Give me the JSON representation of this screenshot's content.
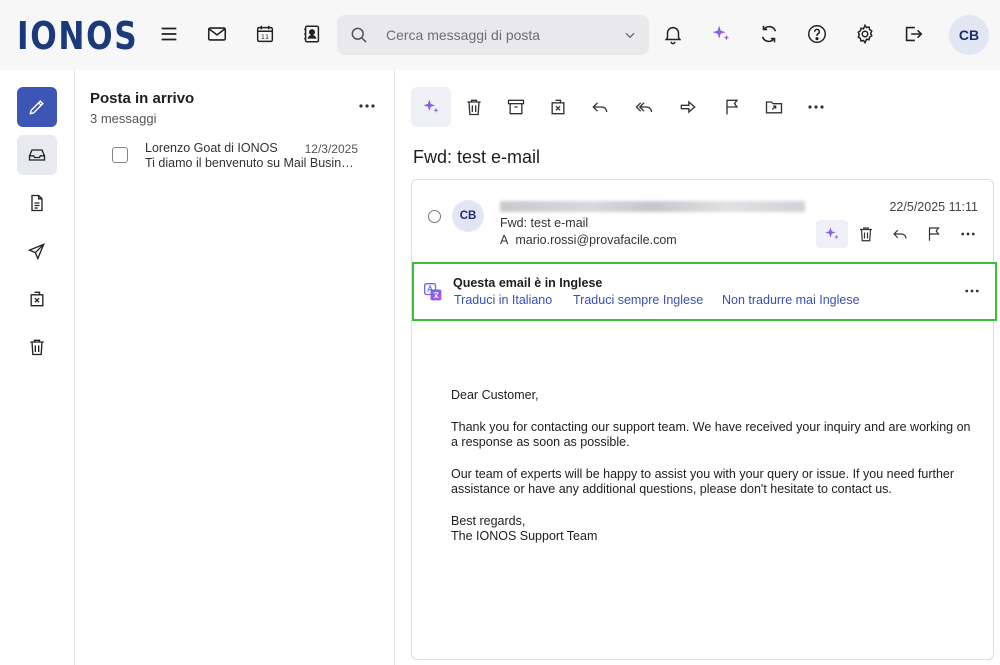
{
  "brand": {
    "logo": "IONOS"
  },
  "topbar": {
    "search_placeholder": "Cerca messaggi di posta",
    "avatar": "CB",
    "icons": [
      "menu-icon",
      "mail-icon",
      "calendar-icon",
      "contacts-icon",
      "bell-icon",
      "ai-sparkle-icon",
      "sync-icon",
      "help-icon",
      "gear-icon",
      "logout-icon"
    ],
    "calendar_day": "11",
    "accent": "#3d55b5"
  },
  "sidebar": {
    "items": [
      "compose",
      "inbox",
      "drafts",
      "sent",
      "spam",
      "trash"
    ]
  },
  "list": {
    "title": "Posta in arrivo",
    "count": "3 messaggi",
    "messages": [
      {
        "sender": "Lorenzo Goat di IONOS",
        "date": "12/3/2025",
        "subject": "Ti diamo il benvenuto su Mail Business"
      }
    ]
  },
  "reader": {
    "subject": "Fwd: test e-mail",
    "avatar": "CB",
    "date": "22/5/2025 11:11",
    "email_subject": "Fwd: test e-mail",
    "to_label": "A",
    "to_address": "mario.rossi@provafacile.com"
  },
  "translate": {
    "title": "Questa email è in Inglese",
    "link1": "Traduci in Italiano",
    "link2": "Traduci sempre Inglese",
    "link3": "Non tradurre mai Inglese",
    "highlight_color": "#38c136"
  },
  "body": {
    "greeting": "Dear Customer,",
    "p1": "Thank you for contacting our support team. We have received your inquiry and are working on a response as soon as possible.",
    "p2": "Our team of experts will be happy to assist you with your query or issue. If you need further assistance or have any additional questions, please don't hesitate to contact us.",
    "closing1": "Best regards,",
    "closing2": "The IONOS Support Team"
  }
}
